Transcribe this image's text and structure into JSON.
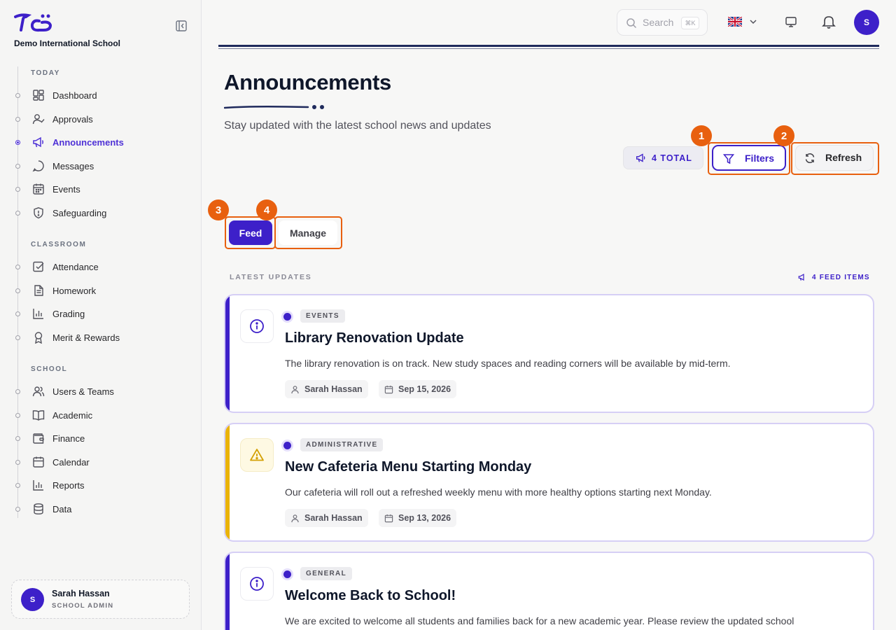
{
  "sidebar": {
    "school_name": "Demo International School",
    "sections": [
      {
        "label": "TODAY",
        "items": [
          {
            "label": "Dashboard",
            "icon": "dashboard-icon"
          },
          {
            "label": "Approvals",
            "icon": "user-check-icon"
          },
          {
            "label": "Announcements",
            "icon": "megaphone-icon",
            "active": true
          },
          {
            "label": "Messages",
            "icon": "chat-icon"
          },
          {
            "label": "Events",
            "icon": "calendar-grid-icon"
          },
          {
            "label": "Safeguarding",
            "icon": "shield-icon"
          }
        ]
      },
      {
        "label": "CLASSROOM",
        "items": [
          {
            "label": "Attendance",
            "icon": "checkbox-icon"
          },
          {
            "label": "Homework",
            "icon": "document-icon"
          },
          {
            "label": "Grading",
            "icon": "bar-chart-icon"
          },
          {
            "label": "Merit & Rewards",
            "icon": "award-icon"
          }
        ]
      },
      {
        "label": "SCHOOL",
        "items": [
          {
            "label": "Users & Teams",
            "icon": "users-icon"
          },
          {
            "label": "Academic",
            "icon": "book-icon"
          },
          {
            "label": "Finance",
            "icon": "wallet-icon"
          },
          {
            "label": "Calendar",
            "icon": "calendar-icon"
          },
          {
            "label": "Reports",
            "icon": "bar-chart-icon"
          },
          {
            "label": "Data",
            "icon": "database-icon"
          }
        ]
      }
    ],
    "user": {
      "initial": "S",
      "name": "Sarah Hassan",
      "role": "SCHOOL ADMIN"
    }
  },
  "topbar": {
    "search_placeholder": "Search",
    "search_shortcut": "⌘K",
    "avatar_initial": "S"
  },
  "header": {
    "title": "Announcements",
    "subtitle": "Stay updated with the latest school news and updates",
    "total_label": "4 TOTAL",
    "filters_label": "Filters",
    "refresh_label": "Refresh"
  },
  "tabs": {
    "feed": "Feed",
    "manage": "Manage"
  },
  "markers": [
    "1",
    "2",
    "3",
    "4"
  ],
  "feed": {
    "heading": "LATEST UPDATES",
    "count_label": "4 FEED ITEMS",
    "cards": [
      {
        "tag": "EVENTS",
        "title": "Library Renovation Update",
        "body": "The library renovation is on track. New study spaces and reading corners will be available by mid-term.",
        "author": "Sarah Hassan",
        "date": "Sep 15, 2026",
        "icon": "info-icon"
      },
      {
        "tag": "ADMINISTRATIVE",
        "title": "New Cafeteria Menu Starting Monday",
        "body": "Our cafeteria will roll out a refreshed weekly menu with more healthy options starting next Monday.",
        "author": "Sarah Hassan",
        "date": "Sep 13, 2026",
        "icon": "warning-icon"
      },
      {
        "tag": "GENERAL",
        "title": "Welcome Back to School!",
        "body": "We are excited to welcome all students and families back for a new academic year. Please review the updated school",
        "icon": "info-icon"
      }
    ]
  },
  "colors": {
    "accent": "#3d20c9",
    "annotation": "#e8600f",
    "warning": "#eab308"
  }
}
